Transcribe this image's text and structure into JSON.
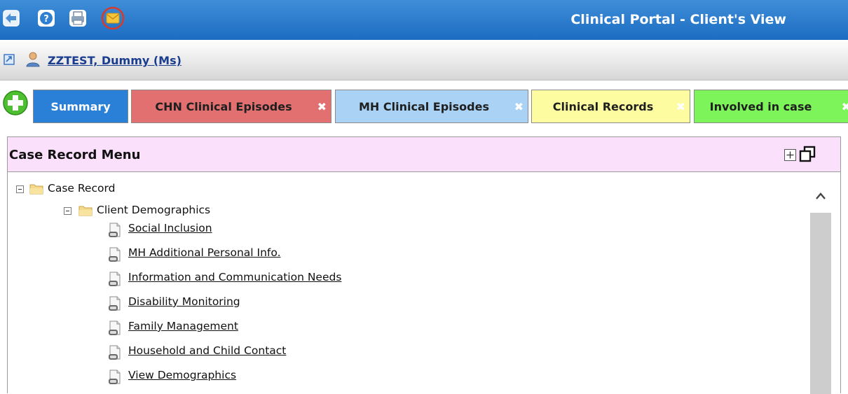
{
  "app": {
    "title": "Clinical Portal - Client's View"
  },
  "toolbar": {
    "icons": [
      "back-arrow-icon",
      "help-icon",
      "print-icon",
      "mail-icon"
    ]
  },
  "patient": {
    "name": "ZZTEST, Dummy (Ms)"
  },
  "tabs": [
    {
      "label": "Summary",
      "color": "#2a7fd6",
      "text_color": "#ffffff",
      "closable": false
    },
    {
      "label": "CHN Clinical Episodes",
      "color": "#e27070",
      "text_color": "#1f1f1f",
      "closable": true
    },
    {
      "label": "MH Clinical Episodes",
      "color": "#a9d2f5",
      "text_color": "#1f1f1f",
      "closable": true
    },
    {
      "label": "Clinical Records",
      "color": "#fdfca0",
      "text_color": "#1f1f1f",
      "closable": true
    },
    {
      "label": "Involved in case",
      "color": "#7cf45a",
      "text_color": "#1f1f1f",
      "closable": true
    }
  ],
  "panel": {
    "title": "Case Record Menu",
    "tree": {
      "root": {
        "label": "Case Record"
      },
      "folder": {
        "label": "Client Demographics"
      },
      "items": [
        "Social Inclusion",
        "MH Additional Personal Info.",
        "Information and Communication Needs",
        "Disability Monitoring",
        "Family Management",
        "Household and Child Contact",
        "View Demographics"
      ]
    }
  }
}
